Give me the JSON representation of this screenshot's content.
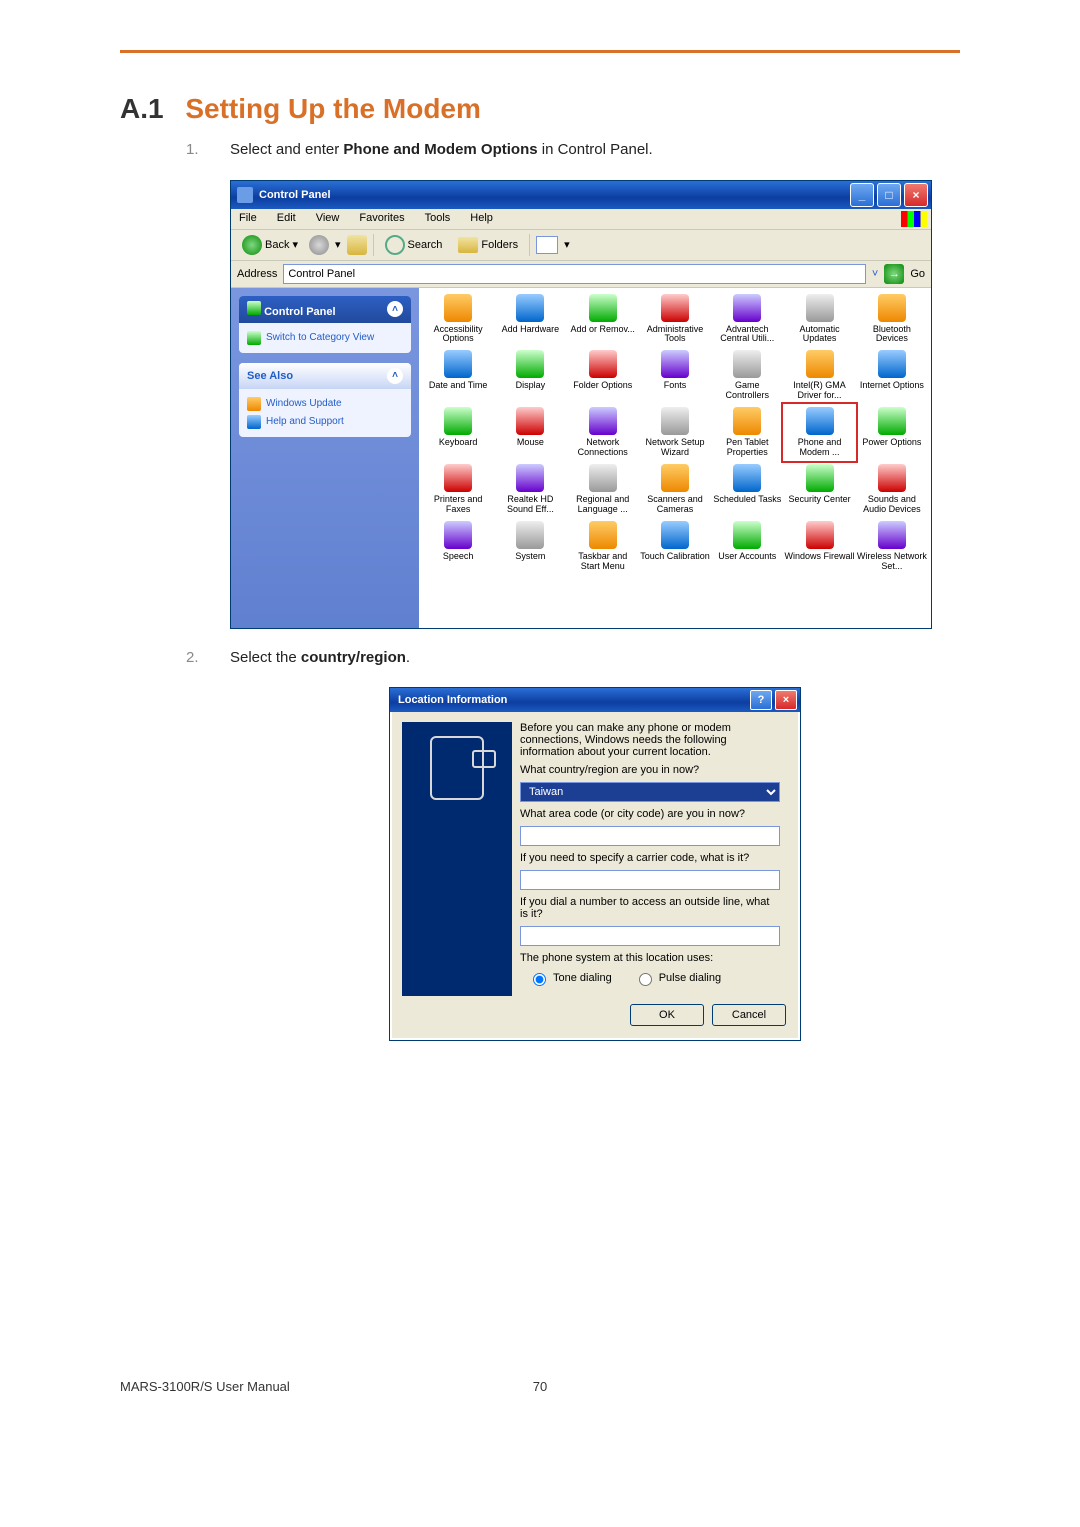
{
  "heading": {
    "number": "A.1",
    "title": "Setting Up the Modem"
  },
  "steps": [
    {
      "n": "1.",
      "pre": "Select and enter ",
      "bold": "Phone and Modem Options",
      "post": " in Control Panel."
    },
    {
      "n": "2.",
      "pre": "Select the ",
      "bold": "country/region",
      "post": "."
    }
  ],
  "cp_window": {
    "title": "Control Panel",
    "menus": [
      "File",
      "Edit",
      "View",
      "Favorites",
      "Tools",
      "Help"
    ],
    "toolbar": {
      "back": "Back",
      "search": "Search",
      "folders": "Folders"
    },
    "locbar": {
      "label": "Address",
      "value": "Control Panel",
      "go": "Go"
    },
    "side": {
      "panel1": {
        "title": "Control Panel",
        "link": "Switch to Category View"
      },
      "panel2": {
        "title": "See Also",
        "links": [
          "Windows Update",
          "Help and Support"
        ]
      }
    },
    "items": [
      "Accessibility Options",
      "Add Hardware",
      "Add or Remov...",
      "Administrative Tools",
      "Advantech Central Utili...",
      "Automatic Updates",
      "Bluetooth Devices",
      "Date and Time",
      "Display",
      "Folder Options",
      "Fonts",
      "Game Controllers",
      "Intel(R) GMA Driver for...",
      "Internet Options",
      "Keyboard",
      "Mouse",
      "Network Connections",
      "Network Setup Wizard",
      "Pen Tablet Properties",
      "Phone and Modem ...",
      "Power Options",
      "Printers and Faxes",
      "Realtek HD Sound Eff...",
      "Regional and Language ...",
      "Scanners and Cameras",
      "Scheduled Tasks",
      "Security Center",
      "Sounds and Audio Devices",
      "Speech",
      "System",
      "Taskbar and Start Menu",
      "Touch Calibration",
      "User Accounts",
      "Windows Firewall",
      "Wireless Network Set..."
    ],
    "highlight_index": 19
  },
  "dialog": {
    "title": "Location Information",
    "intro": "Before you can make any phone or modem connections, Windows needs the following information about your current location.",
    "q_country": "What country/region are you in now?",
    "country_value": "Taiwan",
    "q_area": "What area code (or city code) are you in now?",
    "q_carrier": "If you need to specify a carrier code, what is it?",
    "q_outside": "If you dial a number to access an outside line, what is it?",
    "phone_system": "The phone system at this location uses:",
    "radio_tone": "Tone dialing",
    "radio_pulse": "Pulse dialing",
    "ok": "OK",
    "cancel": "Cancel"
  },
  "footer": {
    "manual": "MARS-3100R/S User Manual",
    "page": "70"
  }
}
